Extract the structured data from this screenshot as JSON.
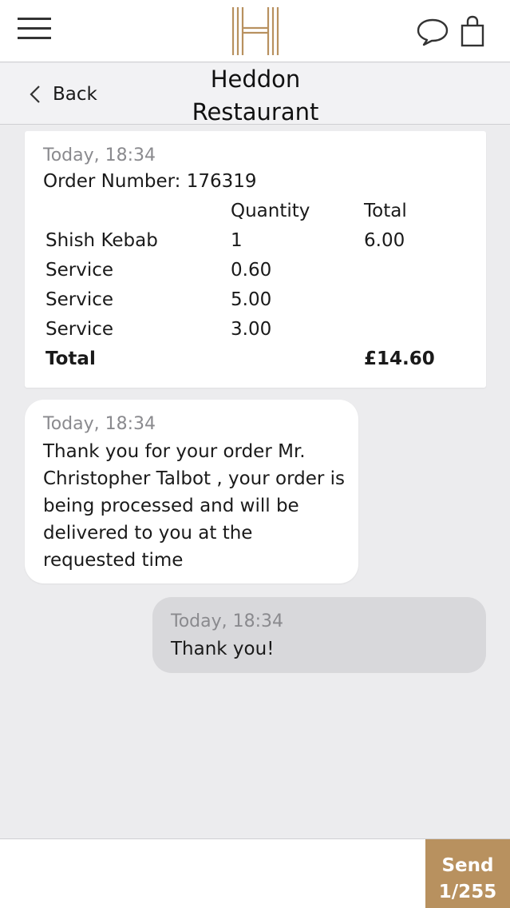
{
  "colors": {
    "brand_gold": "#b8915f",
    "background": "#ececee",
    "outgoing_bubble": "#d8d8db"
  },
  "topbar": {
    "menu_icon": "hamburger-menu-icon",
    "logo_icon": "h-monogram-logo",
    "chat_icon": "chat-bubble-icon",
    "bag_icon": "shopping-bag-icon"
  },
  "subheader": {
    "back_label": "Back",
    "title_line1": "Heddon",
    "title_line2": "Restaurant"
  },
  "order": {
    "time": "Today, 18:34",
    "number_label": "Order Number: 176319",
    "headers": {
      "quantity": "Quantity",
      "total": "Total"
    },
    "items": [
      {
        "name": "Shish Kebab",
        "quantity": "1",
        "total": "6.00"
      },
      {
        "name": "Service",
        "quantity": "0.60",
        "total": ""
      },
      {
        "name": "Service",
        "quantity": "5.00",
        "total": ""
      },
      {
        "name": "Service",
        "quantity": "3.00",
        "total": ""
      }
    ],
    "total_label": "Total",
    "total_value": "£14.60"
  },
  "messages": [
    {
      "direction": "incoming",
      "time": "Today, 18:34",
      "text": "Thank you for your order Mr. Christopher Talbot , your order is being processed and will be delivered to you at the requested time"
    },
    {
      "direction": "outgoing",
      "time": "Today, 18:34",
      "text": "Thank you!"
    }
  ],
  "composer": {
    "value": "",
    "send_label": "Send",
    "char_count": "1/255"
  }
}
